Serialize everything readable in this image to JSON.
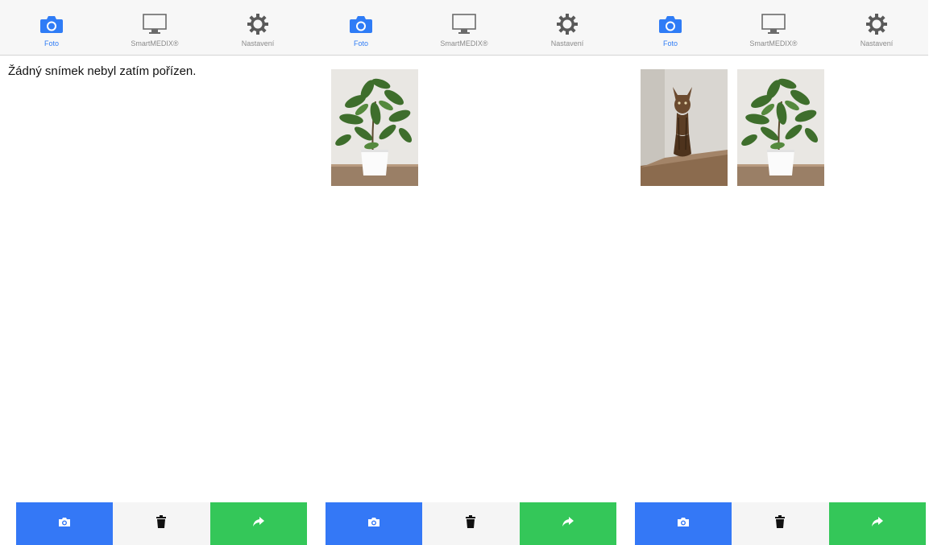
{
  "tabs": [
    {
      "label": "Foto",
      "icon": "camera-icon",
      "active": true
    },
    {
      "label": "SmartMEDIX®",
      "icon": "monitor-icon",
      "active": false
    },
    {
      "label": "Nastavení",
      "icon": "gear-icon",
      "active": false
    }
  ],
  "screens": [
    {
      "empty_message": "Žádný snímek nebyl zatím pořízen.",
      "photos": []
    },
    {
      "photos": [
        "plant"
      ]
    },
    {
      "photos": [
        "cat-statue",
        "plant"
      ]
    }
  ],
  "toolbar": {
    "buttons": [
      {
        "icon": "camera-icon",
        "color": "#3478f6"
      },
      {
        "icon": "trash-icon",
        "color": "#f5f5f5"
      },
      {
        "icon": "share-arrow-icon",
        "color": "#34c759"
      }
    ]
  },
  "colors": {
    "accent": "#2f7cf6",
    "inactive": "#8a8a8a",
    "tabbar_bg": "#f7f7f7"
  }
}
